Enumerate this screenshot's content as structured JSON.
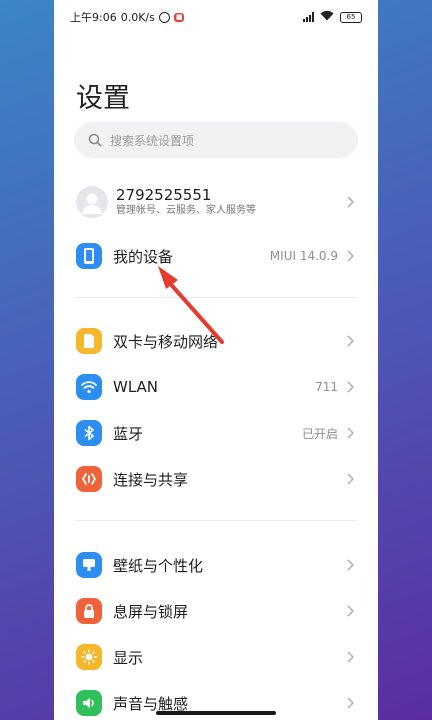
{
  "status_bar": {
    "time": "上午9:06",
    "speed": "0.0K/s",
    "battery": "65"
  },
  "page": {
    "title": "设置",
    "search_placeholder": "搜索系统设置项"
  },
  "account": {
    "name": "2792525551",
    "subtitle": "管理帐号、云服务、家人服务等"
  },
  "items": [
    {
      "label": "我的设备",
      "value": "MIUI 14.0.9",
      "icon": "phone-icon",
      "color": "#2b8ef0"
    },
    {
      "label": "双卡与移动网络",
      "value": "",
      "icon": "sim-card-icon",
      "color": "#f5b72b"
    },
    {
      "label": "WLAN",
      "value": "711",
      "icon": "wifi-icon",
      "color": "#2b8ef0"
    },
    {
      "label": "蓝牙",
      "value": "已开启",
      "icon": "bluetooth-icon",
      "color": "#2b8ef0"
    },
    {
      "label": "连接与共享",
      "value": "",
      "icon": "share-icon",
      "color": "#f0633a"
    },
    {
      "label": "壁纸与个性化",
      "value": "",
      "icon": "wallpaper-icon",
      "color": "#2b8ef0"
    },
    {
      "label": "息屏与锁屏",
      "value": "",
      "icon": "lock-icon",
      "color": "#f0633a"
    },
    {
      "label": "显示",
      "value": "",
      "icon": "sun-icon",
      "color": "#f5b72b"
    },
    {
      "label": "声音与触感",
      "value": "",
      "icon": "speaker-icon",
      "color": "#2fbf5b"
    }
  ]
}
